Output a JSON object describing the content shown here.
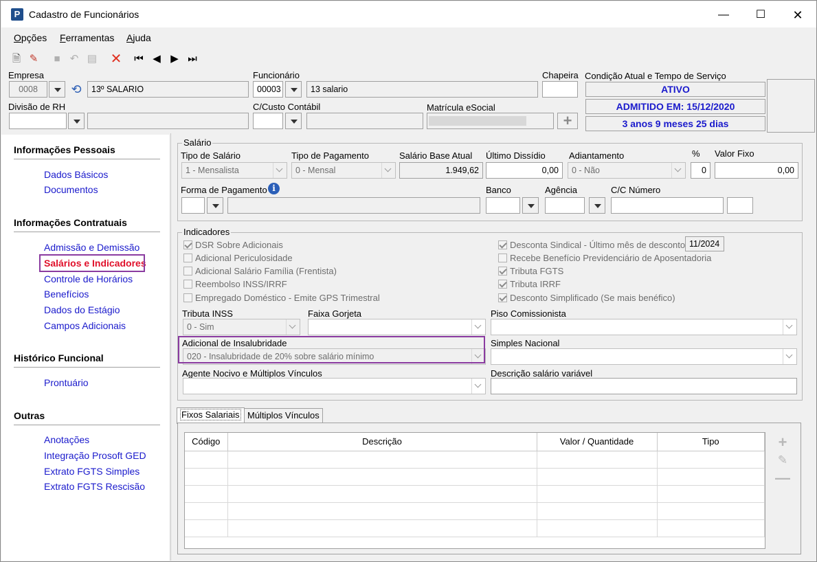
{
  "window": {
    "title": "Cadastro de Funcionários",
    "app_icon": "P"
  },
  "menu": [
    {
      "label": "Opções"
    },
    {
      "label": "Ferramentas"
    },
    {
      "label": "Ajuda"
    }
  ],
  "header": {
    "empresa_label": "Empresa",
    "empresa_code": "0008",
    "empresa_name": "13º SALARIO",
    "funcionario_label": "Funcionário",
    "funcionario_code": "00003",
    "funcionario_name": "13 salario",
    "chapeira_label": "Chapeira",
    "chapeira_value": "",
    "condicao_label": "Condição Atual e Tempo de Serviço",
    "status_ativo": "ATIVO",
    "status_admitido": "ADMITIDO EM: 15/12/2020",
    "status_tempo": "3 anos 9 meses 25 dias",
    "divisao_label": "Divisão de RH",
    "ccusto_label": "C/Custo Contábil",
    "matricula_label": "Matrícula eSocial"
  },
  "sidebar": {
    "sections": [
      {
        "title": "Informações Pessoais",
        "items": [
          "Dados Básicos",
          "Documentos"
        ]
      },
      {
        "title": "Informações Contratuais",
        "items": [
          "Admissão e Demissão",
          "Salários e Indicadores",
          "Controle de Horários",
          "Benefícios",
          "Dados do Estágio",
          "Campos Adicionais"
        ]
      },
      {
        "title": "Histórico Funcional",
        "items": [
          "Prontuário"
        ]
      },
      {
        "title": "Outras",
        "items": [
          "Anotações",
          "Integração Prosoft GED",
          "Extrato FGTS Simples",
          "Extrato FGTS Rescisão"
        ]
      }
    ],
    "active_item": "Salários e Indicadores"
  },
  "salario": {
    "group_title": "Salário",
    "tipo_salario_label": "Tipo de Salário",
    "tipo_salario_value": "1 - Mensalista",
    "tipo_pagamento_label": "Tipo de Pagamento",
    "tipo_pagamento_value": "0 - Mensal",
    "salario_base_label": "Salário Base Atual",
    "salario_base_value": "1.949,62",
    "ultimo_dissidio_label": "Último Dissídio",
    "ultimo_dissidio_value": "0,00",
    "adiantamento_label": "Adiantamento",
    "adiantamento_value": "0 - Não",
    "percent_label": "%",
    "percent_value": "0",
    "valor_fixo_label": "Valor Fixo",
    "valor_fixo_value": "0,00",
    "forma_pagamento_label": "Forma de Pagamento",
    "banco_label": "Banco",
    "agencia_label": "Agência",
    "cc_numero_label": "C/C Número"
  },
  "indicadores": {
    "group_title": "Indicadores",
    "left": [
      {
        "label": "DSR Sobre Adicionais",
        "checked": true
      },
      {
        "label": "Adicional Periculosidade",
        "checked": false
      },
      {
        "label": "Adicional Salário Família (Frentista)",
        "checked": false
      },
      {
        "label": "Reembolso INSS/IRRF",
        "checked": false
      },
      {
        "label": "Empregado Doméstico - Emite GPS Trimestral",
        "checked": false
      }
    ],
    "right": [
      {
        "label": "Desconta Sindical - Último mês de desconto",
        "checked": true
      },
      {
        "label": "Recebe Benefício Previdenciário de Aposentadoria",
        "checked": false
      },
      {
        "label": "Tributa FGTS",
        "checked": true
      },
      {
        "label": "Tributa IRRF",
        "checked": true
      },
      {
        "label": "Desconto Simplificado (Se mais benéfico)",
        "checked": true
      }
    ],
    "ultimo_mes_value": "11/2024",
    "tributa_inss_label": "Tributa INSS",
    "tributa_inss_value": "0 - Sim",
    "faixa_gorjeta_label": "Faixa Gorjeta",
    "piso_comissionista_label": "Piso Comissionista",
    "adicional_insalubridade_label": "Adicional de Insalubridade",
    "adicional_insalubridade_value": "020 - Insalubridade de 20% sobre salário mínimo",
    "simples_nacional_label": "Simples Nacional",
    "agente_nocivo_label": "Agente Nocivo e  Múltiplos Vínculos",
    "descricao_salario_label": "Descrição salário variável"
  },
  "tabs": [
    {
      "label": "Fixos Salariais",
      "selected": true
    },
    {
      "label": "Múltiplos Vínculos",
      "selected": false
    }
  ],
  "grid": {
    "columns": [
      "Código",
      "Descrição",
      "Valor / Quantidade",
      "Tipo"
    ],
    "rows": 6
  },
  "colors": {
    "link": "#1a1acc",
    "active": "#e0102a",
    "highlight": "#8a3ba0",
    "status": "#1a1acc"
  }
}
